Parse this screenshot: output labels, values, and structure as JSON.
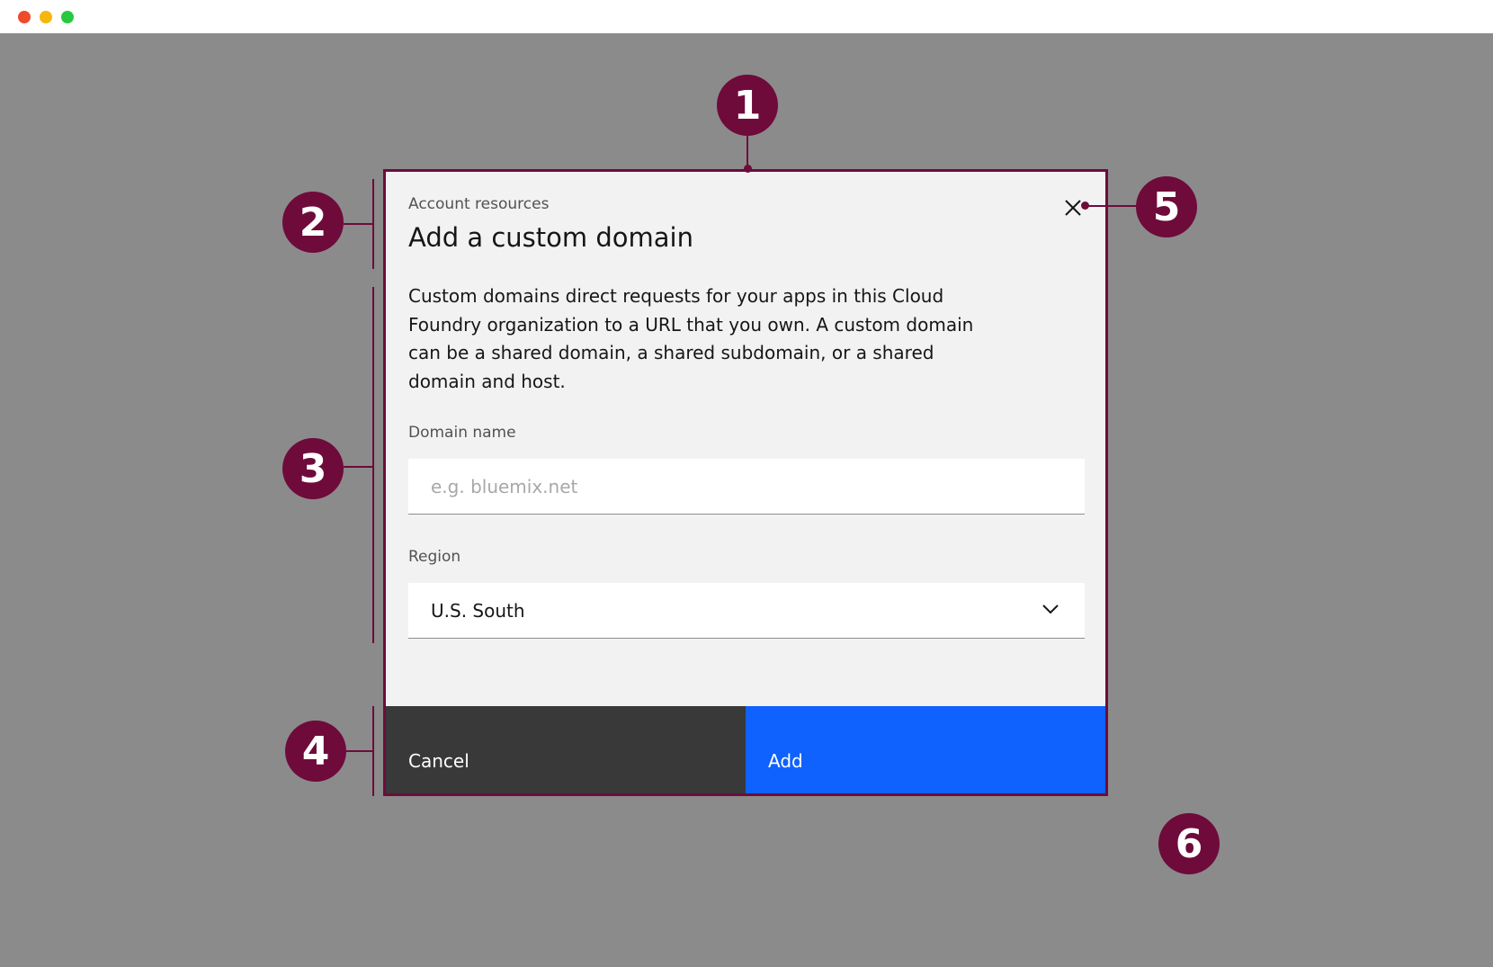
{
  "window": {
    "controls": [
      "close",
      "minimize",
      "maximize"
    ]
  },
  "modal": {
    "label": "Account resources",
    "title": "Add a custom domain",
    "close_icon": "close-icon",
    "body": "Custom domains direct requests for your apps in this Cloud Foundry organization to a URL that you own. A custom domain can be a shared domain, a shared subdomain, or a shared domain and host.",
    "domain_field": {
      "label": "Domain name",
      "placeholder": "e.g. bluemix.net",
      "value": ""
    },
    "region_field": {
      "label": "Region",
      "value": "U.S. South",
      "icon": "chevron-down-icon"
    },
    "buttons": {
      "cancel": "Cancel",
      "add": "Add"
    }
  },
  "annotations": {
    "markers": [
      "1",
      "2",
      "3",
      "4",
      "5",
      "6"
    ],
    "color": "#6e0b3b"
  },
  "colors": {
    "overlay": "#8b8b8b",
    "modal_bg": "#f2f2f2",
    "secondary_button": "#393939",
    "primary_button": "#0f62fe"
  }
}
